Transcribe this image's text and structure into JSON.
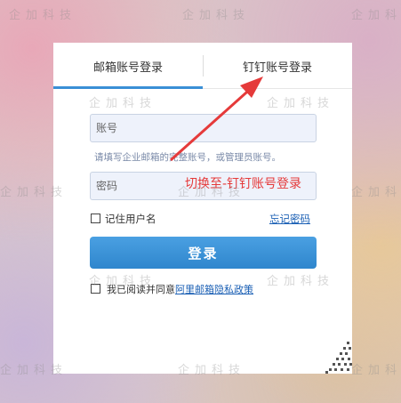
{
  "watermark": {
    "text": "企加科技"
  },
  "tabs": [
    {
      "label": "邮箱账号登录",
      "active": true
    },
    {
      "label": "钉钉账号登录",
      "active": false
    }
  ],
  "form": {
    "account_placeholder": "账号",
    "account_hint": "请填写企业邮箱的完整账号，或管理员账号。",
    "password_placeholder": "密码",
    "remember_label": "记住用户名",
    "forgot_link": "忘记密码",
    "login_button": "登录",
    "agree_prefix": "我已阅读并同意",
    "agree_link": "阿里邮箱隐私政策"
  },
  "annotation": {
    "text": "切换至-钉钉账号登录",
    "color": "#e53a3a"
  },
  "colors": {
    "accent": "#3a8fd6",
    "link": "#1a5fb4",
    "button": "#2f86cd"
  },
  "icons": {
    "qr_corner": "qr-code-icon"
  }
}
